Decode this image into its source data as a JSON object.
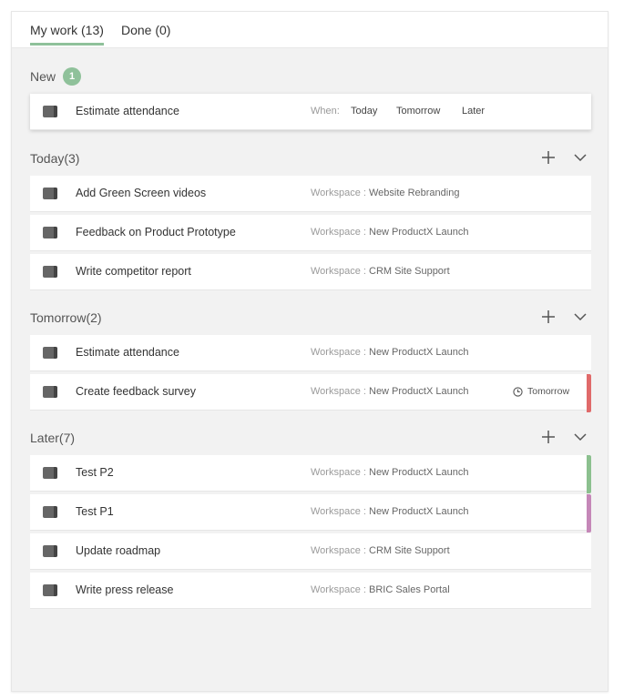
{
  "tabs": [
    {
      "label": "My work (13)"
    },
    {
      "label": "Done (0)"
    }
  ],
  "sections": {
    "new": {
      "title": "New",
      "count_badge": "1"
    },
    "today": {
      "title": "Today(3)"
    },
    "tomorrow": {
      "title": "Tomorrow(2)"
    },
    "later": {
      "title": "Later(7)"
    }
  },
  "new_task": {
    "name": "Estimate attendance",
    "when_label": "When:",
    "when_options": [
      "Today",
      "Tomorrow",
      "Later"
    ]
  },
  "workspace_prefix": "Workspace : ",
  "today_tasks": [
    {
      "name": "Add Green Screen videos",
      "workspace": "Website Rebranding"
    },
    {
      "name": "Feedback on Product Prototype",
      "workspace": "New ProductX Launch"
    },
    {
      "name": "Write competitor report",
      "workspace": "CRM Site Support"
    }
  ],
  "tomorrow_tasks": [
    {
      "name": "Estimate attendance",
      "workspace": "New ProductX Launch"
    },
    {
      "name": "Create feedback survey",
      "workspace": "New ProductX Launch",
      "due": "Tomorrow",
      "priority_color": "#e06a6a"
    }
  ],
  "later_tasks": [
    {
      "name": "Test P2",
      "workspace": "New ProductX Launch",
      "priority_color": "#8cc08f"
    },
    {
      "name": "Test P1",
      "workspace": "New ProductX Launch",
      "priority_color": "#c587b8"
    },
    {
      "name": "Update roadmap",
      "workspace": "CRM Site Support"
    },
    {
      "name": "Write press release",
      "workspace": "BRIC Sales Portal"
    }
  ],
  "colors": {
    "accent": "#8fc19a",
    "panel_bg": "#f2f2f2"
  }
}
